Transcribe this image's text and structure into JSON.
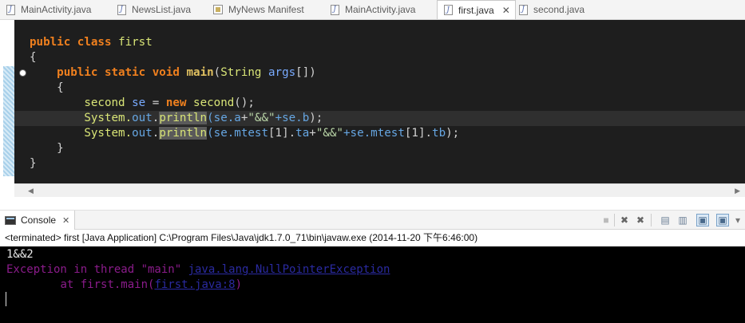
{
  "editor_tabs": [
    {
      "label": "MainActivity.java",
      "icon": "java-file-icon",
      "active": false
    },
    {
      "label": "NewsList.java",
      "icon": "java-file-icon",
      "active": false
    },
    {
      "label": "MyNews Manifest",
      "icon": "manifest-icon",
      "active": false
    },
    {
      "label": "MainActivity.java",
      "icon": "java-file-icon",
      "active": false
    },
    {
      "label": "first.java",
      "icon": "java-file-icon",
      "active": true
    },
    {
      "label": "second.java",
      "icon": "java-file-icon",
      "active": false
    }
  ],
  "editor": {
    "code": {
      "l1": {
        "k1": "public",
        "k2": "class",
        "name": "first"
      },
      "l2": {
        "text": "{"
      },
      "l3": {
        "k1": "public",
        "k2": "static",
        "k3": "void",
        "method": "main",
        "p1": "(",
        "type": "String",
        "param": "args",
        "p2": "[])"
      },
      "l4": {
        "text": "{"
      },
      "l5": {
        "type": "second",
        "var": "se",
        "eq": "=",
        "kw": "new",
        "ctor": "second",
        "rest": "();"
      },
      "l6": {
        "sys": "System.",
        "out": "out",
        "dot": ".",
        "call": "println",
        "p1": "(se.",
        "f1": "a",
        "plus1": "+",
        "s": "\"&&\"",
        "plus2": "+se.",
        "f2": "b",
        "end": ");"
      },
      "l7": {
        "sys": "System.",
        "out": "out",
        "dot": ".",
        "call": "println",
        "p1": "(se.",
        "f1": "mtest",
        "i1": "[1].",
        "f2": "ta",
        "plus1": "+",
        "s": "\"&&\"",
        "plus2": "+se.",
        "f3": "mtest",
        "i2": "[1].",
        "f4": "tb",
        "end": ");"
      },
      "l8": {
        "text": "}"
      },
      "l9": {
        "text": "}"
      }
    }
  },
  "console": {
    "tab_label": "Console",
    "tab_close": "✕",
    "status": "<terminated> first [Java Application] C:\\Program Files\\Java\\jdk1.7.0_71\\bin\\javaw.exe (2014-11-20 下午6:46:00)",
    "output": {
      "line1": "1&&2",
      "line2_prefix": "Exception in thread \"main\" ",
      "line2_link": "java.lang.NullPointerException",
      "line3_prefix": "\tat first.main(",
      "line3_link": "first.java:8",
      "line3_suffix": ")"
    }
  },
  "colors": {
    "editor_bg": "#1e1e1e",
    "keyword": "#f0801e",
    "console_bg": "#000000",
    "error_text": "#8b1c8b",
    "link": "#2a2aa0"
  }
}
